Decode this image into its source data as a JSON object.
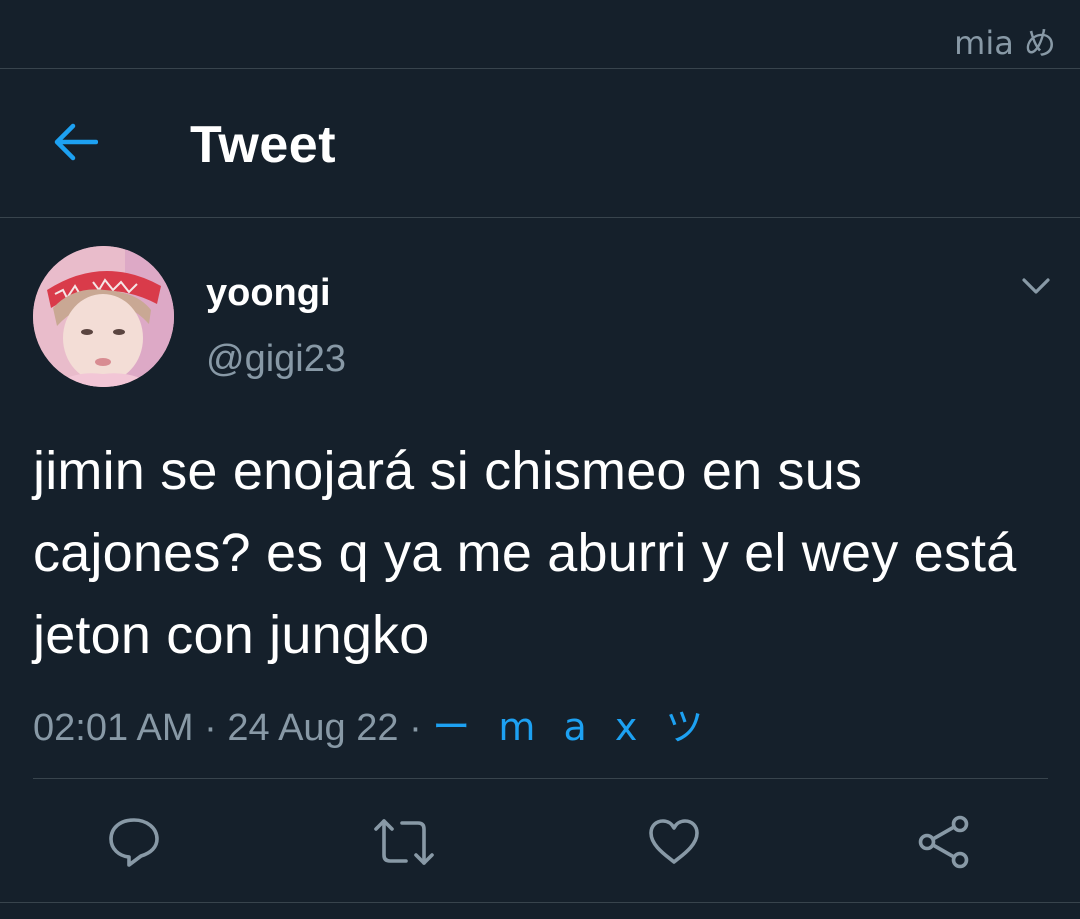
{
  "status_bar": {
    "text": "mia め"
  },
  "header": {
    "title": "Tweet",
    "back_icon": "arrow-left-icon"
  },
  "tweet": {
    "author": {
      "name": "yoongi",
      "handle": "@gigi23"
    },
    "text": "jimin se enojará si chismeo en sus cajones? es q ya me aburri y el wey está jeton con jungko",
    "time": "02:01 AM",
    "date": "24 Aug 22",
    "separator": " · ",
    "source": "ー m a x ツ",
    "more_icon": "chevron-down-icon"
  },
  "actions": [
    {
      "name": "reply",
      "icon": "comment-icon"
    },
    {
      "name": "retweet",
      "icon": "retweet-icon"
    },
    {
      "name": "like",
      "icon": "heart-icon"
    },
    {
      "name": "share",
      "icon": "share-icon"
    }
  ],
  "colors": {
    "background": "#15202b",
    "accent": "#1da1f2",
    "secondary_text": "#8899a6",
    "border": "#38444d"
  }
}
